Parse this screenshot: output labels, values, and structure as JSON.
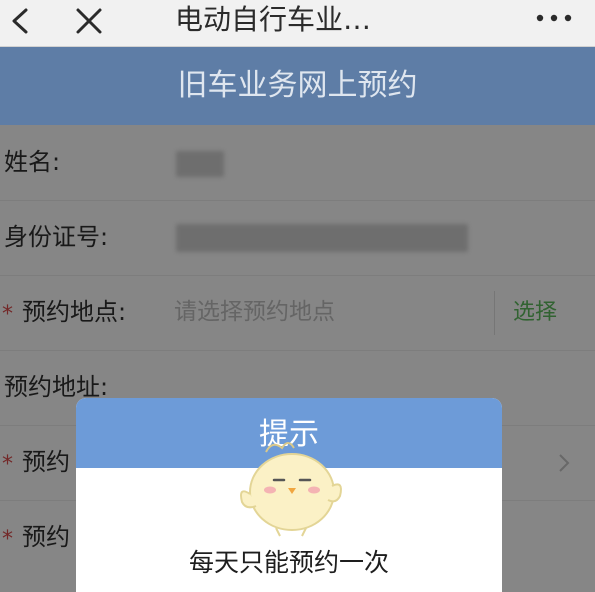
{
  "topbar": {
    "title": "电动自行车业…",
    "back_icon": "chevron-left-icon",
    "close_icon": "close-icon",
    "more_icon": "more-icon"
  },
  "header": {
    "title": "旧车业务网上预约"
  },
  "form": {
    "name_label": "姓名:",
    "id_label": "身份证号:",
    "location_required_mark": "*",
    "location_label": "预约地点:",
    "location_placeholder": "请选择预约地点",
    "location_select": "选择",
    "address_label": "预约地址:",
    "row5_required_mark": "*",
    "row5_label": "预约",
    "row6_required_mark": "*",
    "row6_label": "预约"
  },
  "dialog": {
    "title": "提示",
    "message": "每天只能预约一次",
    "mascot_icon": "chick-mascot-icon"
  },
  "colors": {
    "header_bg": "#5e7da6",
    "dialog_header_bg": "#6d9bd8",
    "select_link": "#5ab45a",
    "required_mark": "#d24a4a"
  }
}
